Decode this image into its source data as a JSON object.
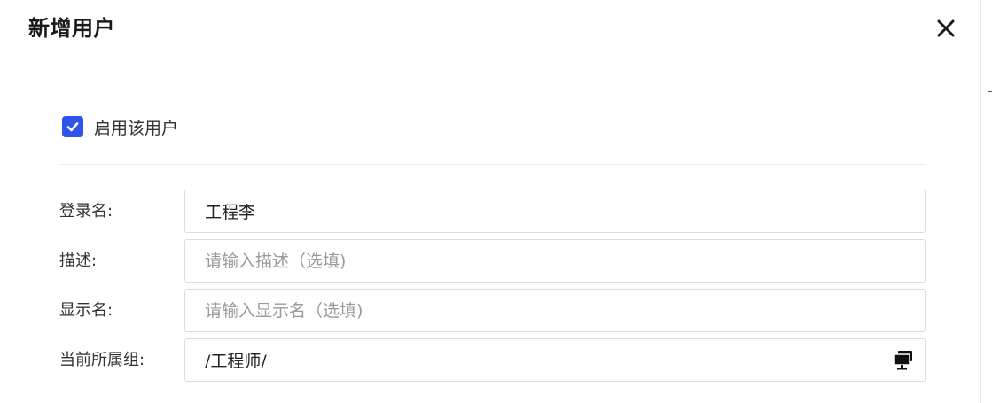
{
  "dialog": {
    "title": "新增用户"
  },
  "enable_user": {
    "label": "启用该用户",
    "checked": true,
    "color": "#2f54eb"
  },
  "form": {
    "login_name": {
      "label": "登录名:",
      "value": "工程李"
    },
    "description": {
      "label": "描述:",
      "value": "",
      "placeholder": "请输入描述（选填)"
    },
    "display_name": {
      "label": "显示名:",
      "value": "",
      "placeholder": "请输入显示名（选填)"
    },
    "current_group": {
      "label": "当前所属组:",
      "value": "/工程师/",
      "icon": "group-select-icon"
    }
  }
}
